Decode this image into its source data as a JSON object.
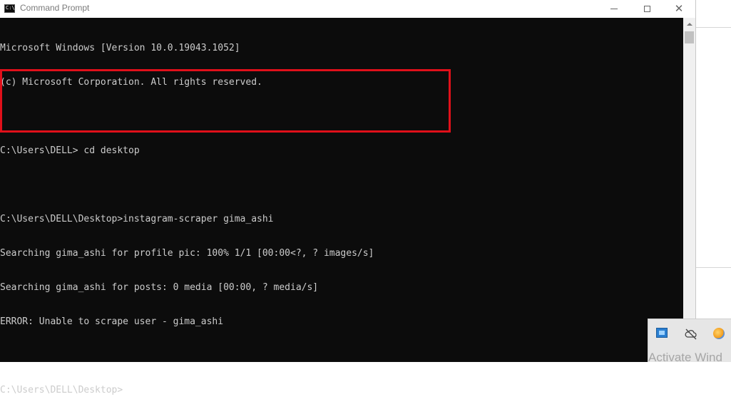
{
  "window": {
    "title": "Command Prompt",
    "app_icon_label": "C:\\",
    "controls": {
      "minimize": "minimize-icon",
      "maximize": "maximize-icon",
      "close": "close-icon",
      "close_glyph": "✕"
    }
  },
  "console": {
    "lines": [
      "Microsoft Windows [Version 10.0.19043.1052]",
      "(c) Microsoft Corporation. All rights reserved.",
      "",
      "C:\\Users\\DELL> cd desktop",
      "",
      "C:\\Users\\DELL\\Desktop>instagram-scraper gima_ashi",
      "Searching gima_ashi for profile pic: 100% 1/1 [00:00<?, ? images/s]",
      "Searching gima_ashi for posts: 0 media [00:00, ? media/s]",
      "ERROR: Unable to scrape user - gima_ashi",
      "",
      "C:\\Users\\DELL\\Desktop>"
    ],
    "highlight_color": "#e0101a",
    "background": "#0c0c0c",
    "foreground": "#cccccc"
  },
  "tray": {
    "icons": [
      "network-display-icon",
      "cloud-offline-icon",
      "color-ball-icon"
    ],
    "watermark": "Activate Wind"
  }
}
